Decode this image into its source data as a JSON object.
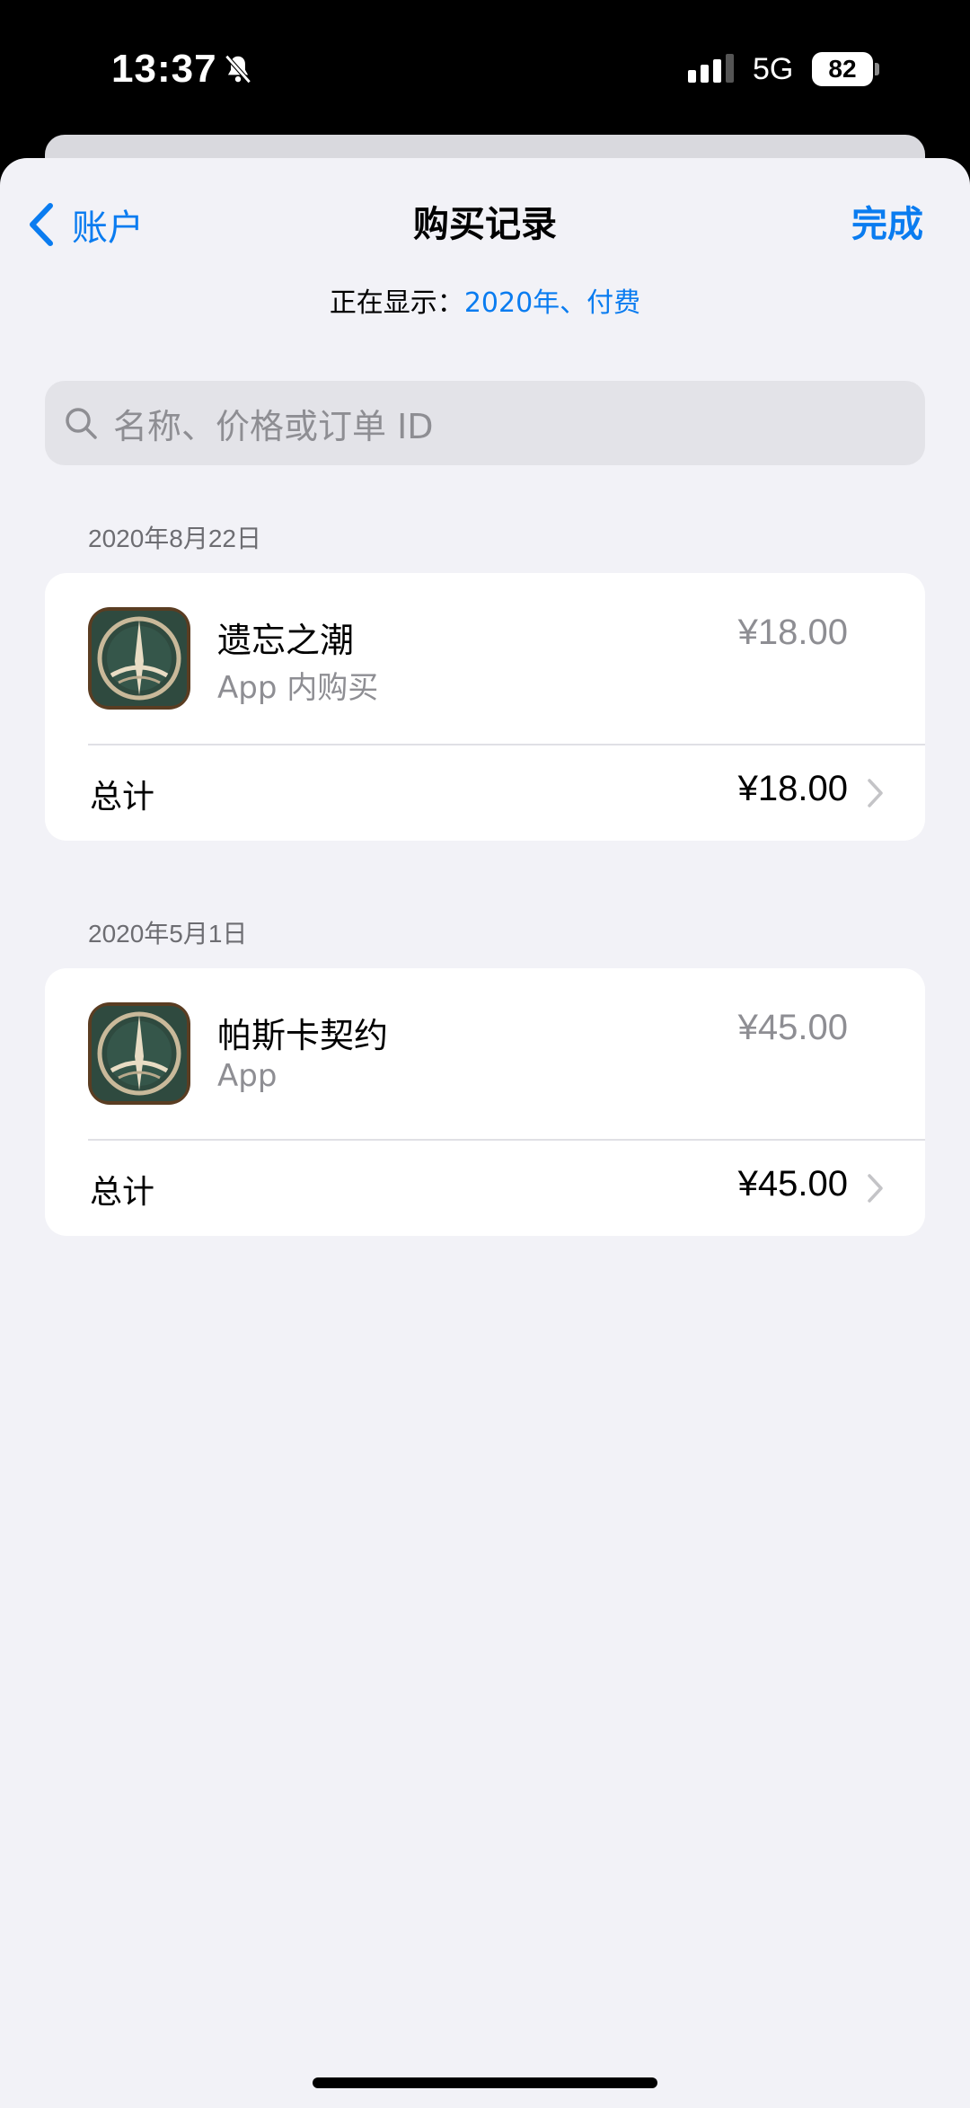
{
  "status_bar": {
    "time": "13:37",
    "network": "5G",
    "battery": "82"
  },
  "nav": {
    "back_label": "账户",
    "title": "购买记录",
    "done_label": "完成"
  },
  "filter": {
    "label": "正在显示：",
    "value": "2020年、付费"
  },
  "search": {
    "placeholder": "名称、价格或订单 ID"
  },
  "purchases": [
    {
      "date": "2020年8月22日",
      "item": {
        "name": "遗忘之潮",
        "type": "App 内购买",
        "price": "¥18.00"
      },
      "total_label": "总计",
      "total_value": "¥18.00"
    },
    {
      "date": "2020年5月1日",
      "item": {
        "name": "帕斯卡契约",
        "type": "App",
        "price": "¥45.00"
      },
      "total_label": "总计",
      "total_value": "¥45.00"
    }
  ],
  "colors": {
    "accent": "#0a7cf0",
    "background": "#f2f2f7",
    "secondary_text": "#8e8e93"
  }
}
